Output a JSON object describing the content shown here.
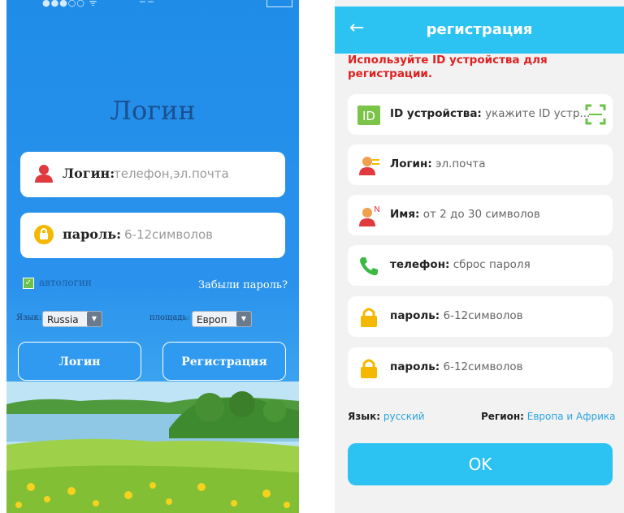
{
  "left_screen": {
    "title": "Логин",
    "login_label": "Логин:",
    "login_placeholder": "телефон,эл.почта",
    "password_label": "пароль:",
    "password_placeholder": "6-12символов",
    "autologin_label": "автологин",
    "forgot_label": "Забыли пароль?",
    "language_label": "Язык:",
    "language_value": "Russia",
    "area_label": "площадь:",
    "area_value": "Европ",
    "login_button": "Логин",
    "register_button": "Регистрация"
  },
  "right_screen": {
    "title": "регистрация",
    "hint": "Используйте ID устройства для регистрации.",
    "rows": [
      {
        "icon": "id-icon",
        "label": "ID устройства:",
        "value": "укажите ID устр..."
      },
      {
        "icon": "user-mail-icon",
        "label": "Логин:",
        "value": "эл.почта"
      },
      {
        "icon": "user-name-icon",
        "label": "Имя:",
        "value": "от 2 до 30 символов"
      },
      {
        "icon": "phone-icon",
        "label": "телефон:",
        "value": "сброс пароля"
      },
      {
        "icon": "lock-icon",
        "label": "пароль:",
        "value": "6-12символов"
      },
      {
        "icon": "lock-icon",
        "label": "пароль:",
        "value": "6-12символов"
      }
    ],
    "language_label": "Язык:",
    "language_value": "русский",
    "region_label": "Регион:",
    "region_value": "Европа и Африка",
    "ok_button": "OK"
  }
}
